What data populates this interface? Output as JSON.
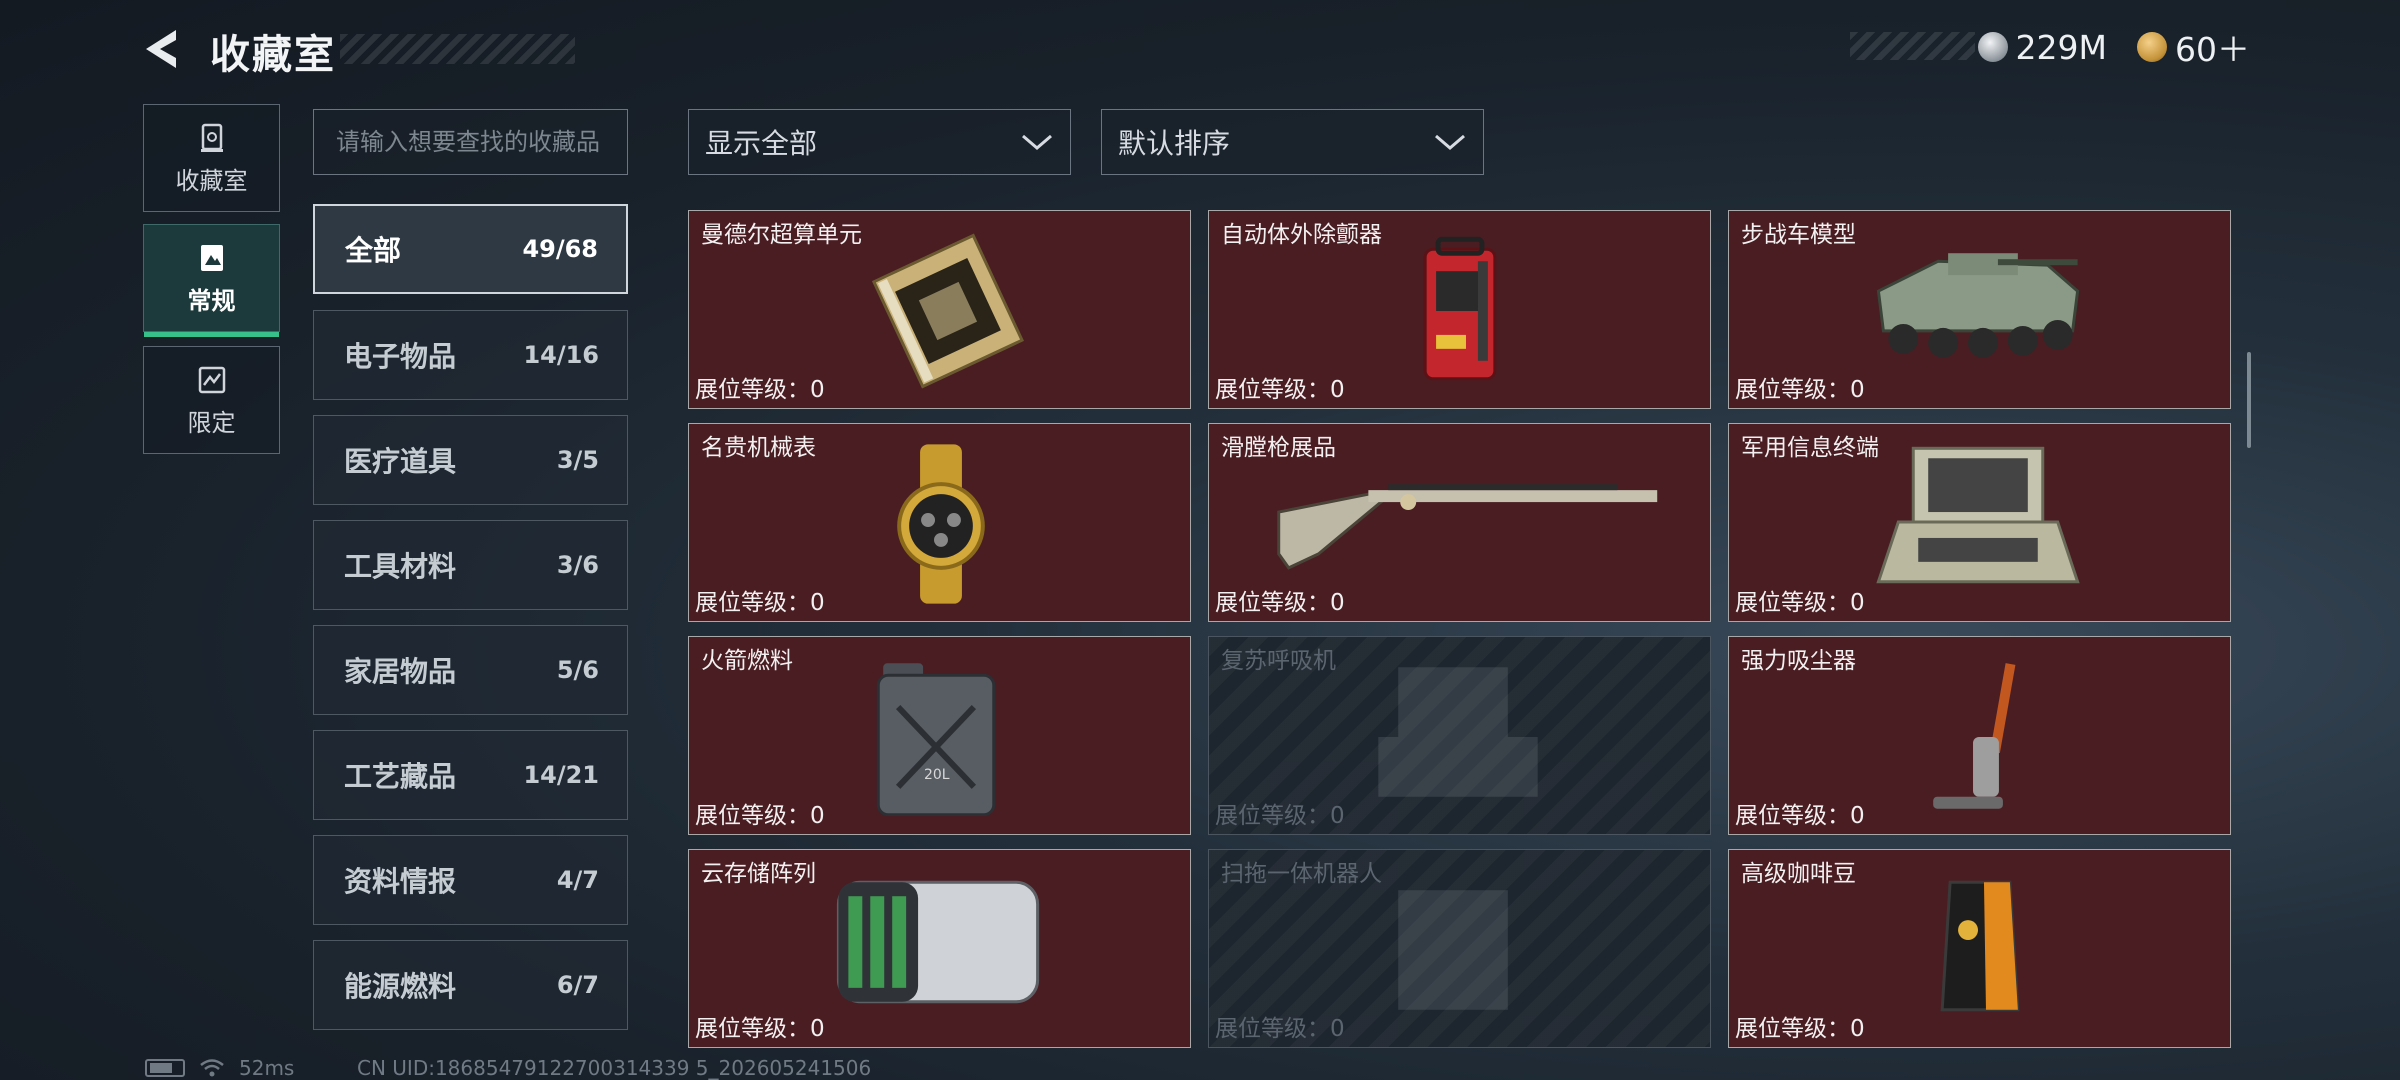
{
  "header": {
    "title": "收藏室",
    "currencies": [
      {
        "icon": "silver-coin-icon",
        "value": "229M"
      },
      {
        "icon": "gold-coin-icon",
        "value": "60＋"
      }
    ]
  },
  "side_tabs": [
    {
      "label": "收藏室",
      "icon": "collection-room-icon",
      "active": false
    },
    {
      "label": "常规",
      "icon": "regular-icon",
      "active": true
    },
    {
      "label": "限定",
      "icon": "limited-icon",
      "active": false
    }
  ],
  "search": {
    "placeholder": "请输入想要查找的收藏品"
  },
  "categories": [
    {
      "name": "全部",
      "count": "49/68",
      "active": true
    },
    {
      "name": "电子物品",
      "count": "14/16"
    },
    {
      "name": "医疗道具",
      "count": "3/5"
    },
    {
      "name": "工具材料",
      "count": "3/6"
    },
    {
      "name": "家居物品",
      "count": "5/6"
    },
    {
      "name": "工艺藏品",
      "count": "14/21"
    },
    {
      "name": "资料情报",
      "count": "4/7"
    },
    {
      "name": "能源燃料",
      "count": "6/7"
    }
  ],
  "filters": {
    "filter_value": "显示全部",
    "sort_value": "默认排序"
  },
  "items": [
    {
      "name": "曼德尔超算单元",
      "level": "展位等级：0",
      "icon": "computing-unit-icon",
      "collected": true
    },
    {
      "name": "自动体外除颤器",
      "level": "展位等级：0",
      "icon": "defibrillator-icon",
      "collected": true
    },
    {
      "name": "步战车模型",
      "level": "展位等级：0",
      "icon": "armored-vehicle-icon",
      "collected": true
    },
    {
      "name": "名贵机械表",
      "level": "展位等级：0",
      "icon": "watch-icon",
      "collected": true
    },
    {
      "name": "滑膛枪展品",
      "level": "展位等级：0",
      "icon": "musket-icon",
      "collected": true
    },
    {
      "name": "军用信息终端",
      "level": "展位等级：0",
      "icon": "terminal-case-icon",
      "collected": true
    },
    {
      "name": "火箭燃料",
      "level": "展位等级：0",
      "icon": "fuel-can-icon",
      "collected": true
    },
    {
      "name": "复苏呼吸机",
      "level": "展位等级：0",
      "icon": "ventilator-icon",
      "collected": false
    },
    {
      "name": "强力吸尘器",
      "level": "展位等级：0",
      "icon": "vacuum-icon",
      "collected": true
    },
    {
      "name": "云存储阵列",
      "level": "展位等级：0",
      "icon": "storage-array-icon",
      "collected": true
    },
    {
      "name": "扫拖一体机器人",
      "level": "展位等级：0",
      "icon": "robot-vacuum-icon",
      "collected": false
    },
    {
      "name": "高级咖啡豆",
      "level": "展位等级：0",
      "icon": "coffee-bag-icon",
      "collected": true
    }
  ],
  "fuel_can_label": "20L",
  "status_bar": {
    "ping": "52ms",
    "uid": "CN UID:18685479122700314339 5_202605241506"
  }
}
